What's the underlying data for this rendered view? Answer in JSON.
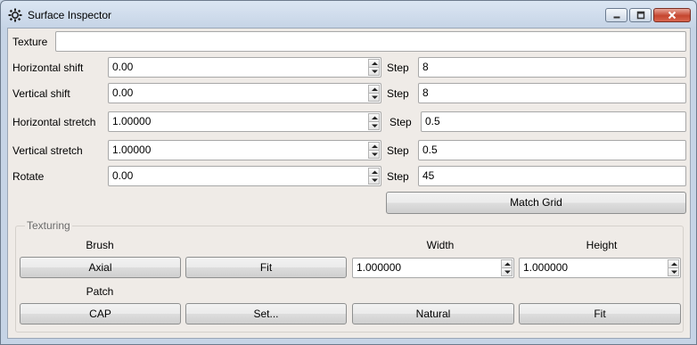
{
  "window": {
    "title": "Surface Inspector",
    "icon": "gear-icon"
  },
  "texture": {
    "label": "Texture",
    "value": ""
  },
  "rows": [
    {
      "label": "Horizontal shift",
      "value": "0.00",
      "step_label": "Step",
      "step": "8"
    },
    {
      "label": "Vertical shift",
      "value": "0.00",
      "step_label": "Step",
      "step": "8"
    },
    {
      "label": "Horizontal stretch",
      "value": "1.00000",
      "step_label": "Step",
      "step": "0.5"
    },
    {
      "label": "Vertical stretch",
      "value": "1.00000",
      "step_label": "Step",
      "step": "0.5"
    },
    {
      "label": "Rotate",
      "value": "0.00",
      "step_label": "Step",
      "step": "45"
    }
  ],
  "match_grid_label": "Match Grid",
  "texturing": {
    "title": "Texturing",
    "brush_label": "Brush",
    "width_label": "Width",
    "height_label": "Height",
    "axial_label": "Axial",
    "fit_label": "Fit",
    "width_value": "1.000000",
    "height_value": "1.000000",
    "patch_label": "Patch",
    "cap_label": "CAP",
    "set_label": "Set...",
    "natural_label": "Natural",
    "patch_fit_label": "Fit"
  }
}
